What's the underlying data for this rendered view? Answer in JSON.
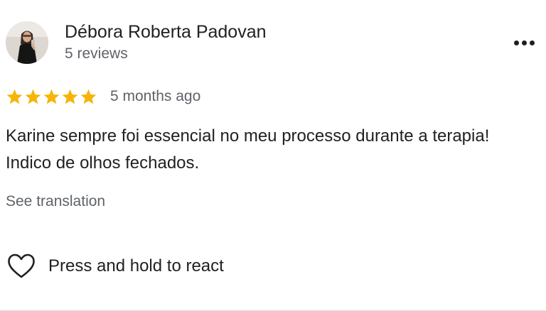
{
  "review": {
    "author": {
      "name": "Débora Roberta Padovan",
      "review_count": "5 reviews"
    },
    "rating": 5,
    "rating_max": 5,
    "date": "5 months ago",
    "text": "Karine sempre foi essencial no meu processo durante a terapia! Indico de olhos fechados.",
    "see_translation": "See translation",
    "react_label": "Press and hold to react"
  },
  "colors": {
    "star": "#f5b50a",
    "secondary_text": "#5f6368",
    "primary_text": "#202124"
  },
  "icons": {
    "more": "more-horizontal-icon",
    "star": "star-icon",
    "react": "heart-outline-icon"
  }
}
